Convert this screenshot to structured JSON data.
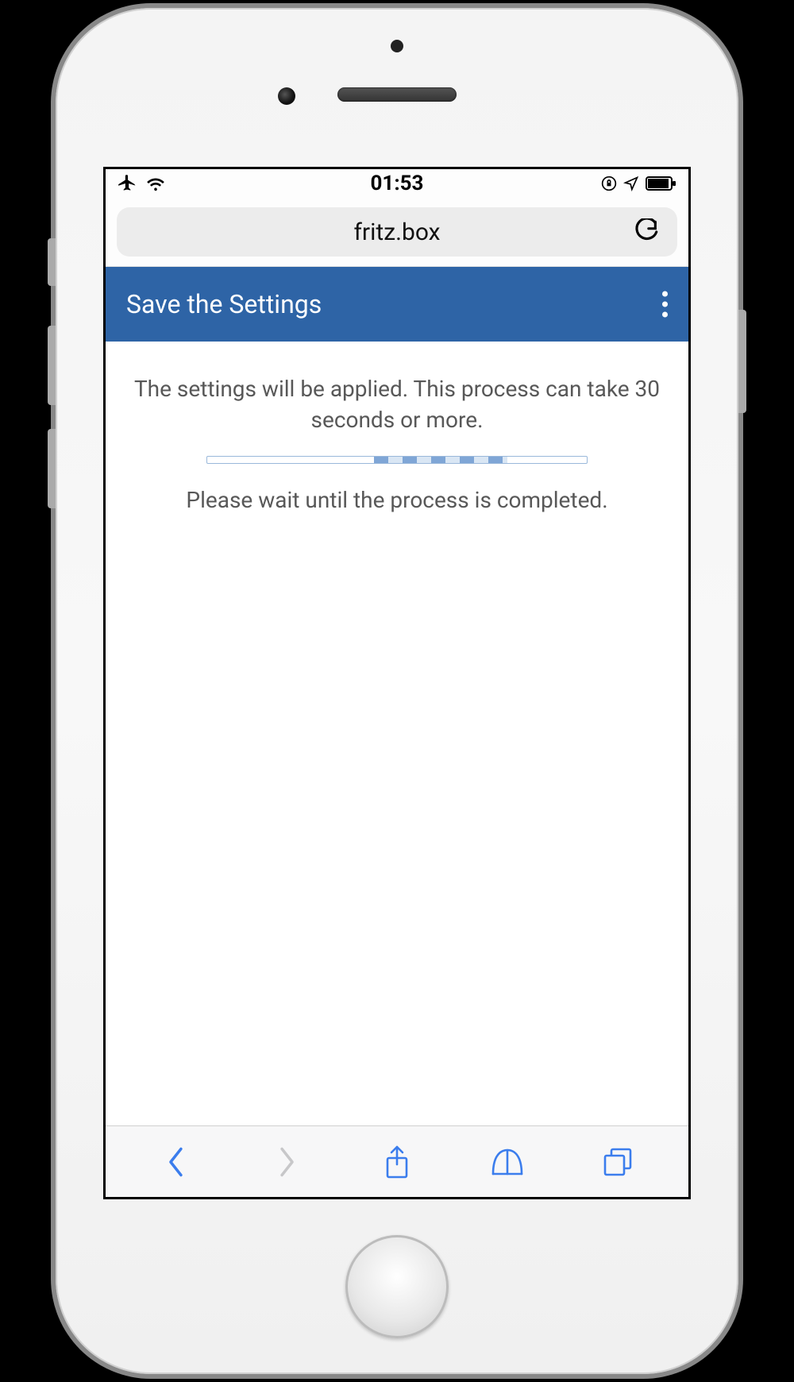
{
  "status_bar": {
    "time": "01:53"
  },
  "browser": {
    "url": "fritz.box"
  },
  "header": {
    "title": "Save the Settings"
  },
  "content": {
    "message_line1": "The settings will be applied. This process can take 30 seconds or more.",
    "message_line2": "Please wait until the process is completed."
  }
}
